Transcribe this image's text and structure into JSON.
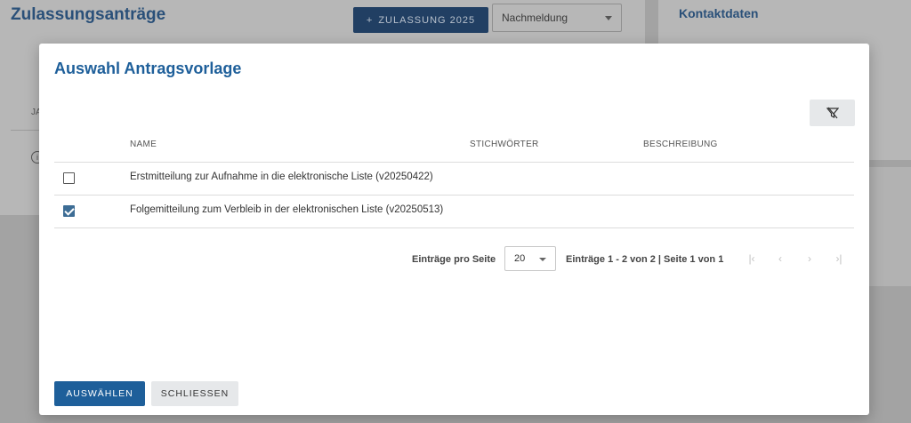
{
  "background": {
    "page_title": "Zulassungsanträge",
    "add_button_icon": "+",
    "add_button_label": "ZULASSUNG 2025",
    "select_value": "Nachmeldung",
    "column_ja": "JA",
    "info_icon": "i",
    "right_title": "Kontaktdaten"
  },
  "modal": {
    "title": "Auswahl Antragsvorlage",
    "filter_icon": "filter-clear-icon",
    "columns": {
      "name": "NAME",
      "keywords": "STICHWÖRTER",
      "description": "BESCHREIBUNG"
    },
    "rows": [
      {
        "name": "Erstmitteilung zur Aufnahme in die elektronische Liste (v20250422)",
        "checked": false
      },
      {
        "name": "Folgemitteilung zum Verbleib in der elektronischen Liste (v20250513)",
        "checked": true
      }
    ],
    "pager": {
      "per_page_label": "Einträge pro Seite",
      "per_page_value": "20",
      "info": "Einträge 1 - 2 von 2 | Seite 1 von 1",
      "first": "|‹",
      "prev": "‹",
      "next": "›",
      "last": "›|"
    },
    "buttons": {
      "select": "AUSWÄHLEN",
      "close": "SCHLIESSEN"
    }
  },
  "colors": {
    "primary": "#1e5f9a",
    "secondary_bg": "#e6e8ea",
    "overlay": "#a3a3a3"
  }
}
